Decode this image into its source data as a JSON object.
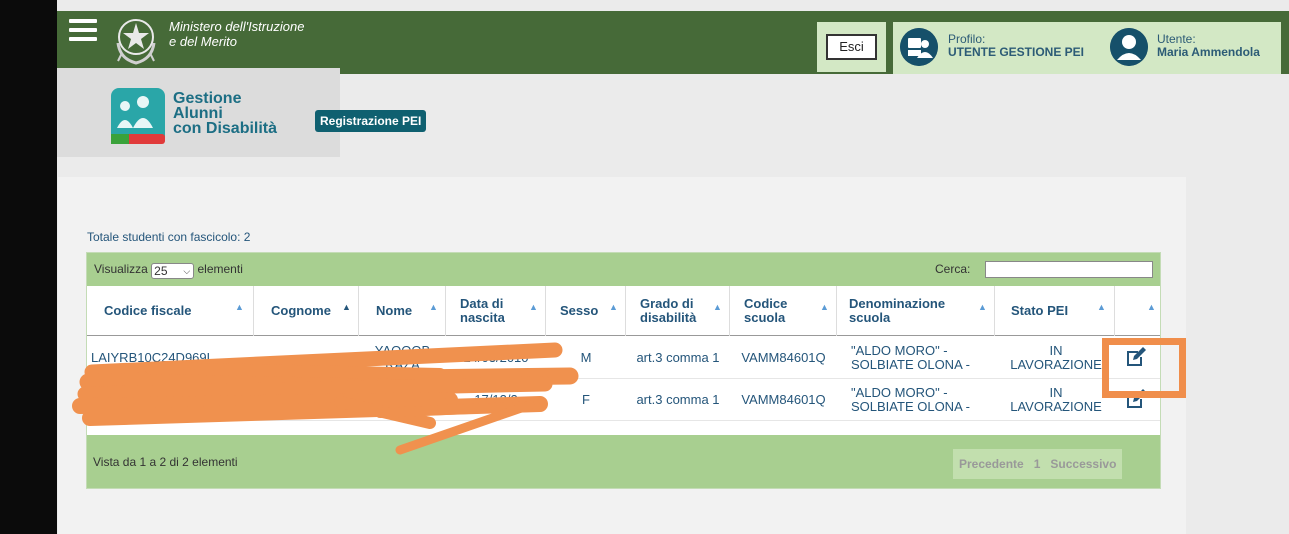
{
  "header": {
    "ministry_line1": "Ministero dell'Istruzione",
    "ministry_line2": "e del Merito",
    "logout_label": "Esci",
    "profile_label": "Profilo:",
    "profile_value": "UTENTE GESTIONE PEI",
    "user_label": "Utente:",
    "user_value": "Maria Ammendola"
  },
  "app": {
    "title_line1": "Gestione",
    "title_line2": "Alunni",
    "title_line3": "con Disabilità",
    "section_badge": "Registrazione PEI"
  },
  "summary": {
    "total_students": "Totale studenti con fascicolo: 2"
  },
  "table_controls": {
    "show_prefix": "Visualizza",
    "page_length": "25",
    "show_suffix": "elementi",
    "search_label": "Cerca:",
    "search_value": ""
  },
  "columns": [
    {
      "label": "Codice fiscale",
      "sort": "none"
    },
    {
      "label": "Cognome",
      "sort": "asc"
    },
    {
      "label": "Nome",
      "sort": "none"
    },
    {
      "label": "Data di nascita",
      "sort": "none"
    },
    {
      "label": "Sesso",
      "sort": "none"
    },
    {
      "label": "Grado di disabilità",
      "sort": "none"
    },
    {
      "label": "Codice scuola",
      "sort": "none"
    },
    {
      "label": "Denominazione scuola",
      "sort": "none"
    },
    {
      "label": "Stato PEI",
      "sort": "none"
    },
    {
      "label": "",
      "sort": "none"
    }
  ],
  "rows": [
    {
      "codice_fiscale": "LAIYRB10C24D969L",
      "cognome": "",
      "nome": "YAQOOB RAZA",
      "data_nascita": "24/03/2010",
      "sesso": "M",
      "grado": "art.3 comma 1",
      "codice_scuola": "VAMM84601Q",
      "denominazione": "\"ALDO MORO\" - SOLBIATE OLONA -",
      "stato": "IN LAVORAZIONE",
      "action_icon": "edit-icon"
    },
    {
      "codice_fiscale": "BR",
      "cognome": "",
      "nome": "",
      "data_nascita": "17/12/2",
      "sesso": "F",
      "grado": "art.3 comma 1",
      "codice_scuola": "VAMM84601Q",
      "denominazione": "\"ALDO MORO\" - SOLBIATE OLONA -",
      "stato": "IN LAVORAZIONE",
      "action_icon": "edit-icon"
    }
  ],
  "footer": {
    "info": "Vista da 1 a 2 di 2 elementi",
    "previous": "Precedente",
    "current_page": "1",
    "next": "Successivo"
  },
  "colors": {
    "header_green": "#466a38",
    "table_bar_green": "#a8cf90",
    "badge_teal": "#0f6070",
    "link_blue": "#24557a",
    "annotation_orange": "#f08e4b",
    "redaction_orange": "#f0914e"
  }
}
